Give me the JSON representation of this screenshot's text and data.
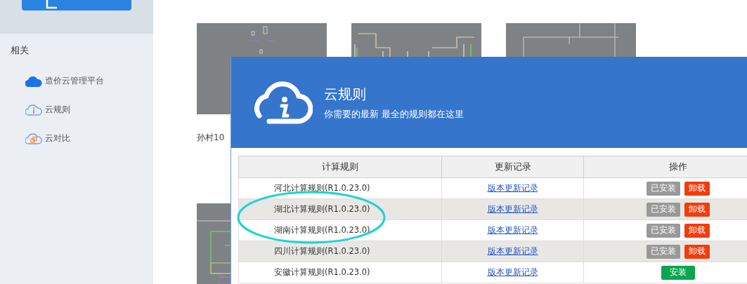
{
  "sidebar": {
    "section_title": "相关",
    "items": [
      {
        "label": "造价云管理平台",
        "kind": "solid"
      },
      {
        "label": "云规则",
        "kind": "info"
      },
      {
        "label": "云对比",
        "kind": "compare"
      }
    ]
  },
  "projects": [
    {
      "caption": "孙村10",
      "kind": "sparse"
    },
    {
      "kind": "plan"
    },
    {
      "kind": "lines"
    },
    {
      "kind": "floorplan"
    }
  ],
  "dialog": {
    "title": "云规则",
    "subtitle": "你需要的最新 最全的规则都在这里",
    "table": {
      "columns": [
        "计算规则",
        "更新记录",
        "操作"
      ],
      "rows": [
        {
          "rule": "河北计算规则(R1.0.23.0)",
          "log": "版本更新记录",
          "actions": [
            {
              "label": "已安装",
              "kind": "installed"
            },
            {
              "label": "卸载",
              "kind": "uninstall"
            }
          ]
        },
        {
          "rule": "湖北计算规则(R1.0.23.0)",
          "log": "版本更新记录",
          "actions": [
            {
              "label": "已安装",
              "kind": "installed"
            },
            {
              "label": "卸载",
              "kind": "uninstall"
            }
          ]
        },
        {
          "rule": "湖南计算规则(R1.0.23.0)",
          "log": "版本更新记录",
          "actions": [
            {
              "label": "已安装",
              "kind": "installed"
            },
            {
              "label": "卸载",
              "kind": "uninstall"
            }
          ]
        },
        {
          "rule": "四川计算规则(R1.0.23.0)",
          "log": "版本更新记录",
          "actions": [
            {
              "label": "已安装",
              "kind": "installed"
            },
            {
              "label": "卸载",
              "kind": "uninstall"
            }
          ]
        },
        {
          "rule": "安徽计算规则(R1.0.23.0)",
          "log": "版本更新记录",
          "actions": [
            {
              "label": "安装",
              "kind": "install"
            }
          ]
        }
      ]
    }
  }
}
